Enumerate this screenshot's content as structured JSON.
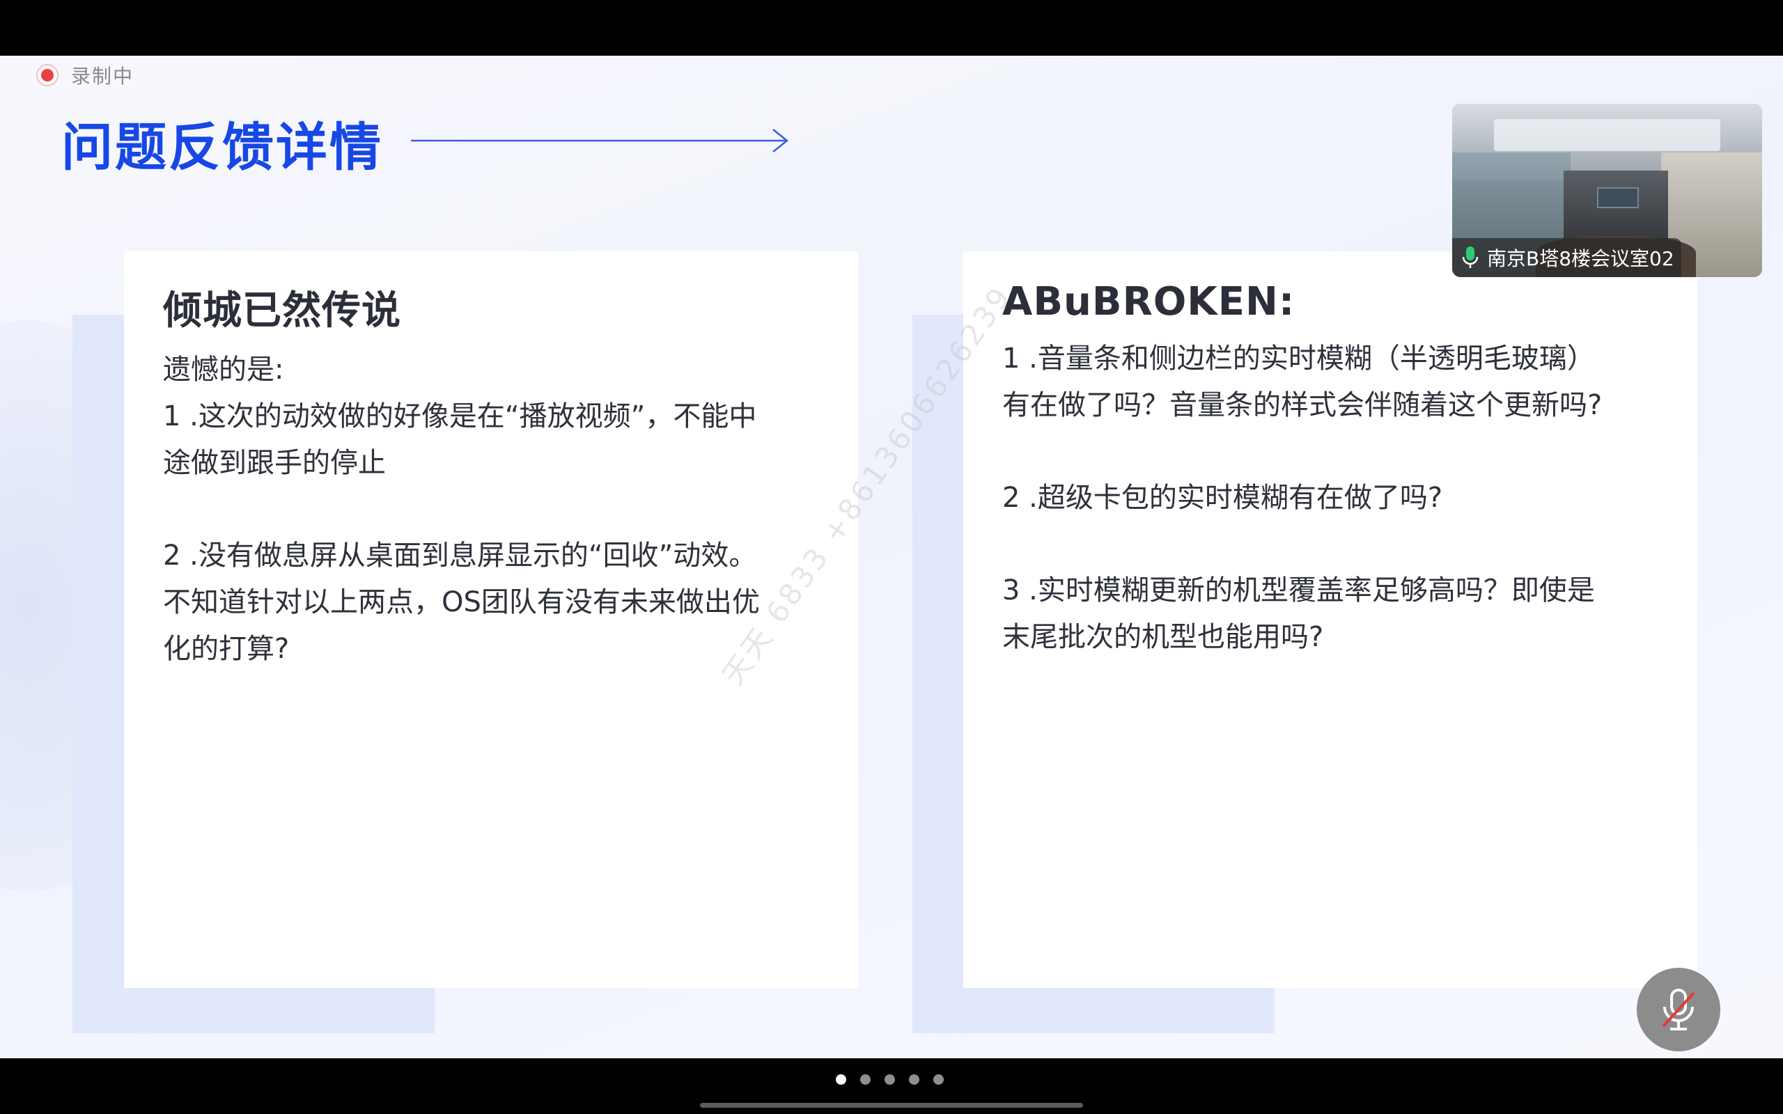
{
  "recording": {
    "label": "录制中",
    "icon": "record-dot-icon"
  },
  "slide": {
    "title": "问题反馈详情",
    "cards": [
      {
        "heading": "倾城已然传说",
        "paragraphs": [
          "遗憾的是:\n1 .这次的动效做的好像是在“播放视频”，不能中\n途做到跟手的停止",
          "2 .没有做息屏从桌面到息屏显示的“回收”动效。\n不知道针对以上两点，OS团队有没有未来做出优\n化的打算?"
        ]
      },
      {
        "heading": "ABuBROKEN:",
        "paragraphs": [
          "1 .音量条和侧边栏的实时模糊（半透明毛玻璃）\n有在做了吗？音量条的样式会伴随着这个更新吗?",
          "2 .超级卡包的实时模糊有在做了吗?",
          "3 .实时模糊更新的机型覆盖率足够高吗？即使是\n末尾批次的机型也能用吗?"
        ]
      }
    ],
    "watermark": "天天 6833 +8613606626239"
  },
  "video_tile": {
    "label": "南京B塔8楼会议室02",
    "icon": "microphone-icon"
  },
  "controls": {
    "mic_button_icon": "microphone-muted-icon"
  },
  "pagination": {
    "total": 5,
    "active_index": 0
  },
  "colors": {
    "title": "#1747e6",
    "card_shadow": "#e2e8fb",
    "record": "#ec4141"
  }
}
